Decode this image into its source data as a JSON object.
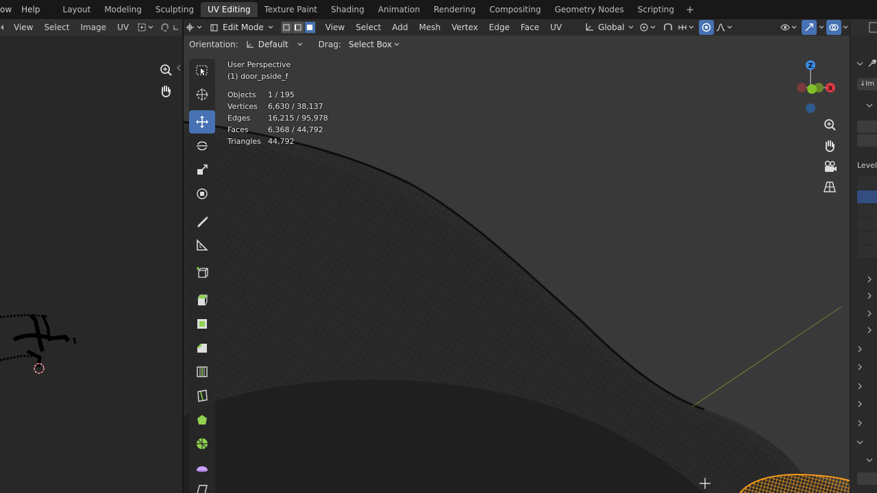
{
  "topbar": {
    "menu": [
      "ow",
      "Help"
    ],
    "workspaces": [
      {
        "label": "Layout",
        "active": false
      },
      {
        "label": "Modeling",
        "active": false
      },
      {
        "label": "Sculpting",
        "active": false
      },
      {
        "label": "UV Editing",
        "active": true
      },
      {
        "label": "Texture Paint",
        "active": false
      },
      {
        "label": "Shading",
        "active": false
      },
      {
        "label": "Animation",
        "active": false
      },
      {
        "label": "Rendering",
        "active": false
      },
      {
        "label": "Compositing",
        "active": false
      },
      {
        "label": "Geometry Nodes",
        "active": false
      },
      {
        "label": "Scripting",
        "active": false
      }
    ],
    "add_label": "+"
  },
  "uv_editor": {
    "menus": {
      "view": "View",
      "select": "Select",
      "image": "Image",
      "uv": "UV"
    }
  },
  "viewport": {
    "mode": "Edit Mode",
    "menus": {
      "view": "View",
      "select": "Select",
      "add": "Add",
      "mesh": "Mesh",
      "vertex": "Vertex",
      "edge": "Edge",
      "face": "Face",
      "uv": "UV"
    },
    "transform_orientation": "Global",
    "orientation_label": "Orientation:",
    "orientation_value": "Default",
    "drag_label": "Drag:",
    "drag_value": "Select Box",
    "perspective": "User Perspective",
    "object_name": "(1) door_pside_f",
    "stats": [
      {
        "key": "Objects",
        "value": "1 / 195"
      },
      {
        "key": "Vertices",
        "value": "6,630 / 38,137"
      },
      {
        "key": "Edges",
        "value": "16,215 / 95,978"
      },
      {
        "key": "Faces",
        "value": "6,368 / 44,792"
      },
      {
        "key": "Triangles",
        "value": "44,792"
      }
    ],
    "gizmo_z_label": "Z",
    "gizmo_x_label": "X"
  },
  "properties": {
    "level_label": "Level",
    "import_label": "Im"
  },
  "colors": {
    "accent": "#4772b3",
    "x_axis": "#e23c48",
    "y_axis": "#82be29",
    "z_axis": "#3c8be2",
    "selection": "#f59a1a"
  }
}
